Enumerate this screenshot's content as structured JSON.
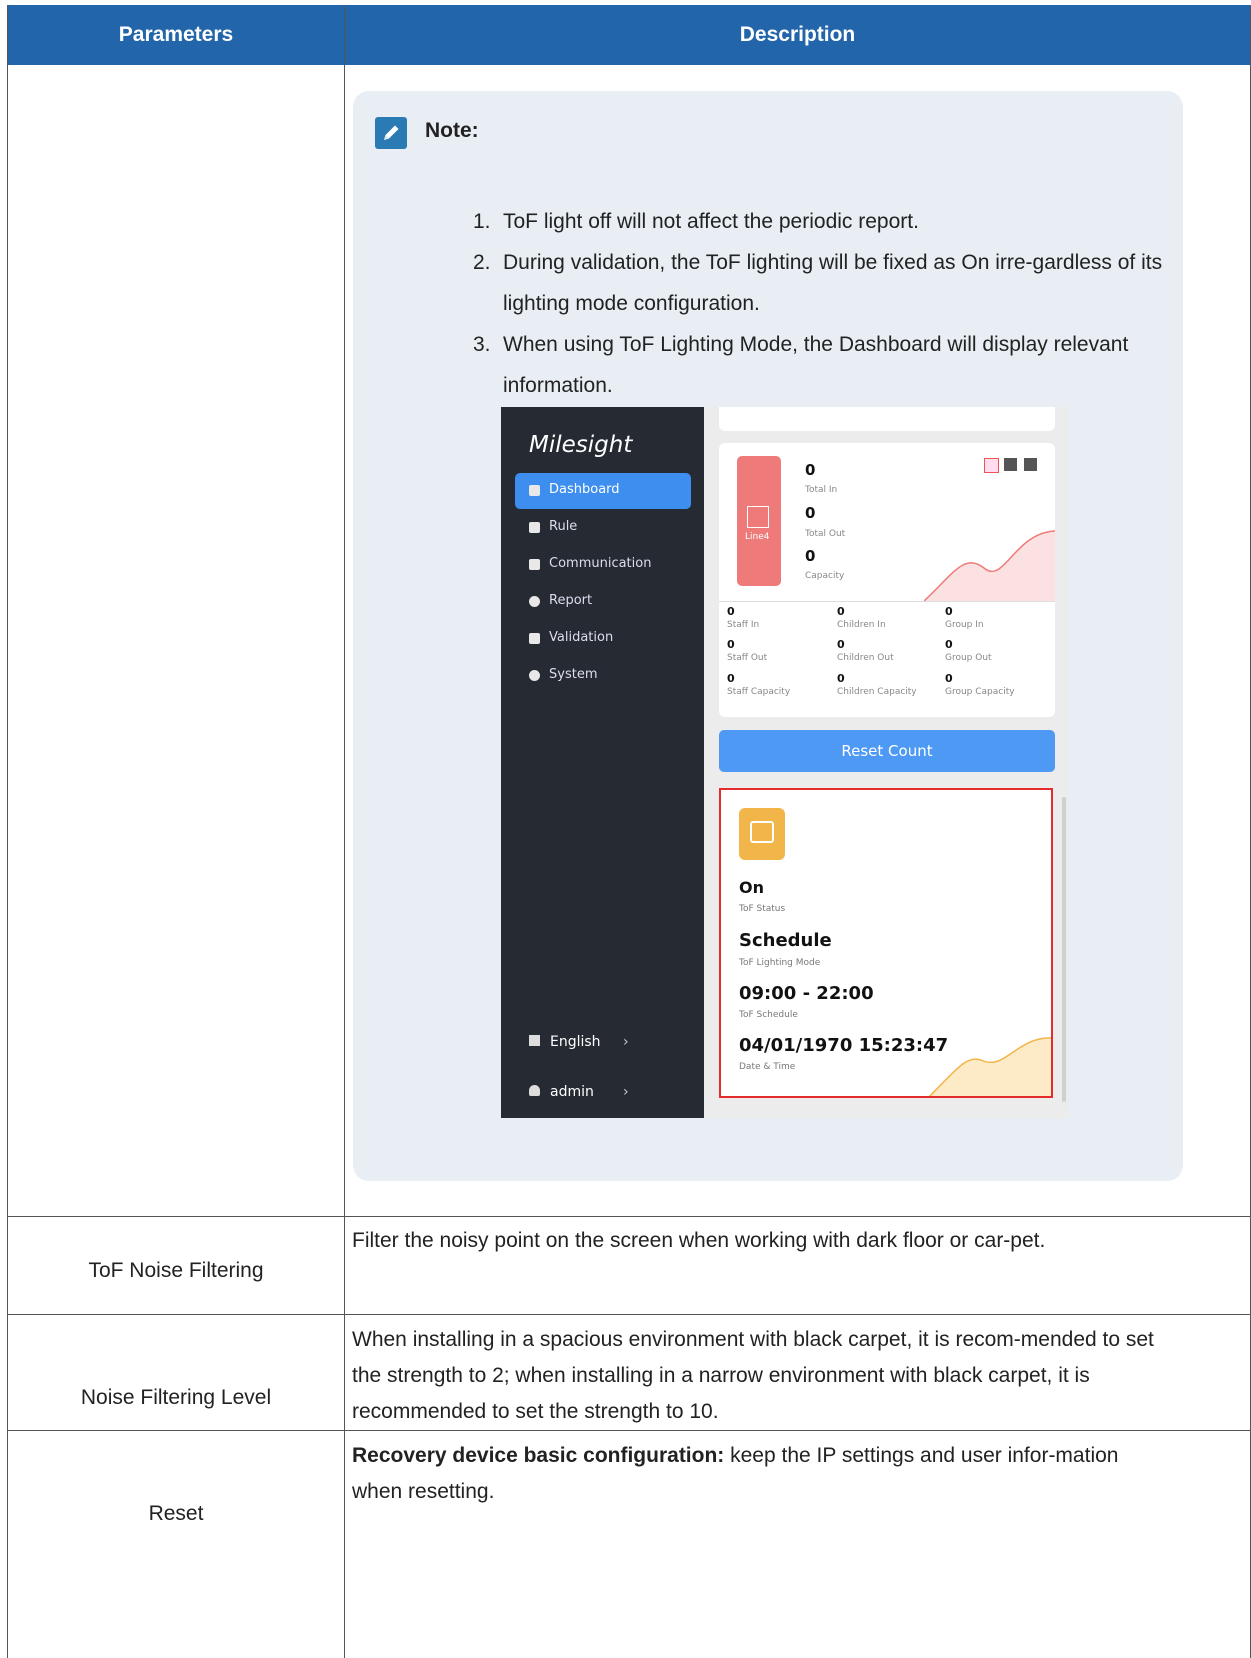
{
  "header": {
    "col_parameters": "Parameters",
    "col_description": "Description"
  },
  "note": {
    "title": "Note:",
    "items": [
      {
        "num": "1.",
        "text": "ToF light off will not affect the periodic report."
      },
      {
        "num": "2.",
        "text": "During validation, the ToF lighting will be fixed as On irre-gardless of its lighting mode configuration."
      },
      {
        "num": "3.",
        "text": "When using ToF Lighting Mode, the Dashboard will display relevant information."
      }
    ]
  },
  "screenshot": {
    "logo": "Milesight",
    "nav": [
      "Dashboard",
      "Rule",
      "Communication",
      "Report",
      "Validation",
      "System"
    ],
    "language": "English",
    "user": "admin",
    "line_label": "Line4",
    "total_in": "0",
    "total_in_label": "Total In",
    "total_out": "0",
    "total_out_label": "Total Out",
    "capacity": "0",
    "capacity_label": "Capacity",
    "stats": [
      {
        "value": "0",
        "label": "Staff In"
      },
      {
        "value": "0",
        "label": "Children In"
      },
      {
        "value": "0",
        "label": "Group In"
      },
      {
        "value": "0",
        "label": "Staff Out"
      },
      {
        "value": "0",
        "label": "Children Out"
      },
      {
        "value": "0",
        "label": "Group Out"
      },
      {
        "value": "0",
        "label": "Staff Capacity"
      },
      {
        "value": "0",
        "label": "Children Capacity"
      },
      {
        "value": "0",
        "label": "Group Capacity"
      }
    ],
    "reset_count": "Reset Count",
    "tof_status": "On",
    "tof_status_label": "ToF Status",
    "lighting_mode": "Schedule",
    "lighting_mode_label": "ToF Lighting Mode",
    "schedule": "09:00 - 22:00",
    "schedule_label": "ToF Schedule",
    "datetime": "04/01/1970 15:23:47",
    "datetime_label": "Date & Time"
  },
  "rows": [
    {
      "param": "ToF Noise Filtering",
      "desc": "Filter the noisy point on the screen when working with dark floor or car-pet."
    },
    {
      "param": "Noise Filtering Level",
      "desc": "When installing in a spacious environment with black carpet, it is recom-mended to set the strength to 2; when installing in a narrow environment with black carpet, it is recommended to set the strength to 10."
    },
    {
      "param": "Reset",
      "desc_bold": "Recovery device basic configuration:",
      "desc": " keep the IP settings and user infor-mation when resetting."
    }
  ],
  "colors": {
    "header": "#2365ab",
    "note_bg": "#e8eef3",
    "accent_blue": "#3d8eef",
    "highlight_red": "#e52b2b"
  }
}
